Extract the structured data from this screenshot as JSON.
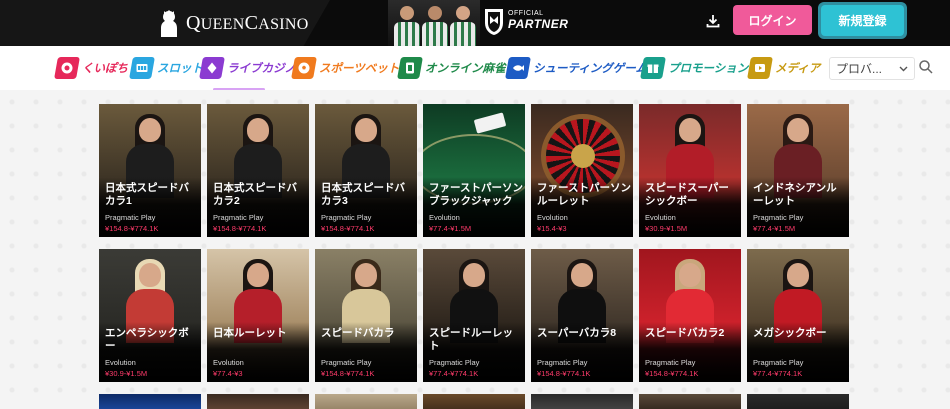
{
  "header": {
    "logo_text": "QueenCasino",
    "logo_text_q": "Q",
    "logo_text_rest": "UEEN",
    "logo_text_c": "C",
    "logo_text_rest2": "ASINO",
    "partner_small": "OFFICIAL",
    "partner_big": "PARTNER",
    "login_label": "ログイン",
    "signup_label": "新規登録",
    "colors": {
      "login": "#f05a9a",
      "signup": "#2ec2d4",
      "bg": "#0b0b0b"
    }
  },
  "nav": {
    "items": [
      {
        "label": "くいぽち",
        "color": "#e6285a",
        "icon": "chat-bubble-icon"
      },
      {
        "label": "スロット",
        "color": "#2aa6e0",
        "icon": "slot-machine-icon"
      },
      {
        "label": "ライブカジノ",
        "color": "#8b3bd1",
        "icon": "diamond-icon"
      },
      {
        "label": "スポーツベット",
        "color": "#f07a1e",
        "icon": "ball-icon"
      },
      {
        "label": "オンライン麻雀",
        "color": "#1f8a4a",
        "icon": "mahjong-tile-icon"
      },
      {
        "label": "シューティングゲーム",
        "color": "#1d5bc4",
        "icon": "fish-icon"
      },
      {
        "label": "プロモーション",
        "color": "#19a08c",
        "icon": "gift-icon"
      },
      {
        "label": "メディア",
        "color": "#c79a12",
        "icon": "media-icon"
      }
    ],
    "provider_select": "プロバ..."
  },
  "games": [
    {
      "title": "日本式スピードバカラ1",
      "provider": "Pragmatic Play",
      "price": "¥154.8-¥774.1K",
      "theme": "dealer-f-dark"
    },
    {
      "title": "日本式スピードバカラ2",
      "provider": "Pragmatic Play",
      "price": "¥154.8-¥774.1K",
      "theme": "dealer-f-dark"
    },
    {
      "title": "日本式スピードバカラ3",
      "provider": "Pragmatic Play",
      "price": "¥154.8-¥774.1K",
      "theme": "dealer-f-dark"
    },
    {
      "title": "ファーストパーソンブラックジャック",
      "provider": "Evolution",
      "price": "¥77.4-¥1.5M",
      "theme": "table-green"
    },
    {
      "title": "ファーストパーソンルーレット",
      "provider": "Evolution",
      "price": "¥15.4-¥3",
      "theme": "roulette"
    },
    {
      "title": "スピードスーパーシックボー",
      "provider": "Evolution",
      "price": "¥30.9-¥1.5M",
      "theme": "dealer-f-red"
    },
    {
      "title": "インドネシアンルーレット",
      "provider": "Pragmatic Play",
      "price": "¥77.4-¥1.5M",
      "theme": "dealer-f-brown"
    },
    {
      "title": "エンペラシックボー",
      "provider": "Evolution",
      "price": "¥30.9-¥1.5M",
      "theme": "dealer-f-blonde"
    },
    {
      "title": "日本ルーレット",
      "provider": "Evolution",
      "price": "¥77.4-¥3",
      "theme": "dealer-f-light"
    },
    {
      "title": "スピードバカラ",
      "provider": "Pragmatic Play",
      "price": "¥154.8-¥774.1K",
      "theme": "dealer-f-cream"
    },
    {
      "title": "スピードルーレット",
      "provider": "Pragmatic Play",
      "price": "¥77.4-¥774.1K",
      "theme": "dealer-m"
    },
    {
      "title": "スーパーバカラ8",
      "provider": "Pragmatic Play",
      "price": "¥154.8-¥774.1K",
      "theme": "dealer-f-black"
    },
    {
      "title": "スピードバカラ2",
      "provider": "Pragmatic Play",
      "price": "¥154.8-¥774.1K",
      "theme": "dealer-f-crimson"
    },
    {
      "title": "メガシックボー",
      "provider": "Pragmatic Play",
      "price": "¥77.4-¥774.1K",
      "theme": "dealer-f-redq"
    }
  ]
}
